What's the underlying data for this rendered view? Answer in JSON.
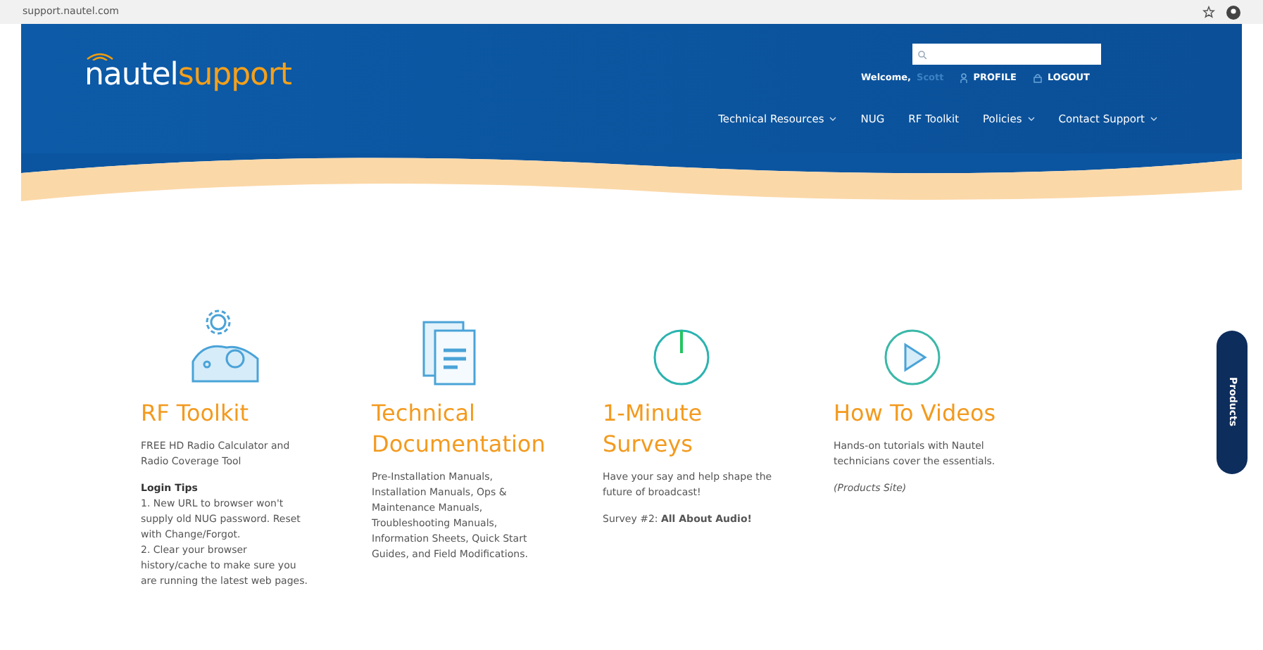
{
  "address_bar": {
    "url": "support.nautel.com"
  },
  "header": {
    "logo": {
      "first": "nautel",
      "second": "support"
    },
    "welcome": "Welcome,",
    "user": "Scott",
    "links": [
      {
        "label": "PROFILE",
        "kind": "person"
      },
      {
        "label": "LOGOUT",
        "kind": "lock"
      }
    ],
    "nav": [
      {
        "label": "Technical Resources",
        "dropdown": true
      },
      {
        "label": "NUG",
        "dropdown": false
      },
      {
        "label": "RF Toolkit",
        "dropdown": false
      },
      {
        "label": "Policies",
        "dropdown": true
      },
      {
        "label": "Contact Support",
        "dropdown": true
      }
    ]
  },
  "cards": [
    {
      "kind": "gears",
      "title": "RF Toolkit",
      "paragraphs": [
        {
          "kind": "text",
          "text": "FREE HD Radio Calculator and Radio Coverage Tool"
        },
        {
          "kind": "heading",
          "text": "Login Tips"
        },
        {
          "kind": "tight",
          "text": "1. New URL to browser won't supply old NUG password. Reset with Change/Forgot."
        },
        {
          "kind": "text",
          "text": "2. Clear your browser history/cache to make sure you are running the latest web pages."
        }
      ]
    },
    {
      "kind": "document",
      "title": "Technical Documentation",
      "paragraphs": [
        {
          "kind": "text",
          "text": "Pre-Installation Manuals, Installation Manuals, Ops & Maintenance Manuals, Troubleshooting Manuals, Information Sheets, Quick Start Guides, and Field Modifications."
        }
      ]
    },
    {
      "kind": "timer",
      "title": "1-Minute Surveys",
      "paragraphs": [
        {
          "kind": "text",
          "text": "Have your say and help shape the future of broadcast!"
        },
        {
          "kind": "text",
          "text": "Survey #2: **All About Audio!**"
        }
      ]
    },
    {
      "kind": "play",
      "title": "How To Videos",
      "paragraphs": [
        {
          "kind": "text",
          "text": "Hands-on tutorials with Nautel technicians cover the essentials."
        },
        {
          "kind": "italic",
          "text": "(Products Site)"
        }
      ]
    }
  ],
  "side_tab": {
    "label": "Products"
  }
}
